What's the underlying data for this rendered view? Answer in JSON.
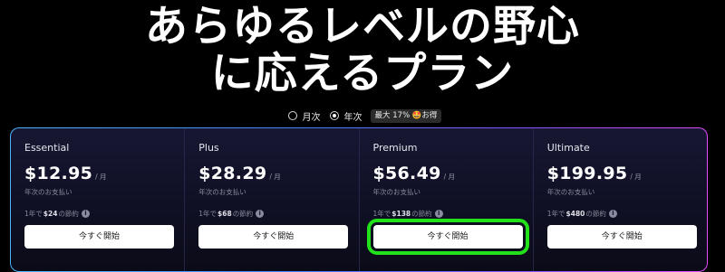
{
  "hero": {
    "line1": "あらゆるレベルの野心",
    "line2": "に応えるプラン"
  },
  "billing_toggle": {
    "monthly_label": "月次",
    "yearly_label": "年次",
    "selected": "年次",
    "save_badge": "最大 17% 🤩お得"
  },
  "plans": [
    {
      "name": "Essential",
      "price": "$12.95",
      "per": "/ 月",
      "billing_note": "年次のお支払い",
      "savings_prefix": "1年で",
      "savings_amount": "$24",
      "savings_suffix": "の節約",
      "button_label": "今すぐ開始"
    },
    {
      "name": "Plus",
      "price": "$28.29",
      "per": "/ 月",
      "billing_note": "年次のお支払い",
      "savings_prefix": "1年で",
      "savings_amount": "$68",
      "savings_suffix": "の節約",
      "button_label": "今すぐ開始"
    },
    {
      "name": "Premium",
      "price": "$56.49",
      "per": "/ 月",
      "billing_note": "年次のお支払い",
      "savings_prefix": "1年で",
      "savings_amount": "$138",
      "savings_suffix": "の節約",
      "button_label": "今すぐ開始"
    },
    {
      "name": "Ultimate",
      "price": "$199.95",
      "per": "/ 月",
      "billing_note": "年次のお支払い",
      "savings_prefix": "1年で",
      "savings_amount": "$480",
      "savings_suffix": "の節約",
      "button_label": "今すぐ開始"
    }
  ],
  "colors": {
    "highlight_outline": "#22e01a",
    "card_border_gradient": [
      "#4bb6ff",
      "#4a7bff",
      "#8a54ff",
      "#e24cff"
    ],
    "background": "#000000"
  },
  "icons": {
    "info": "info-icon"
  }
}
